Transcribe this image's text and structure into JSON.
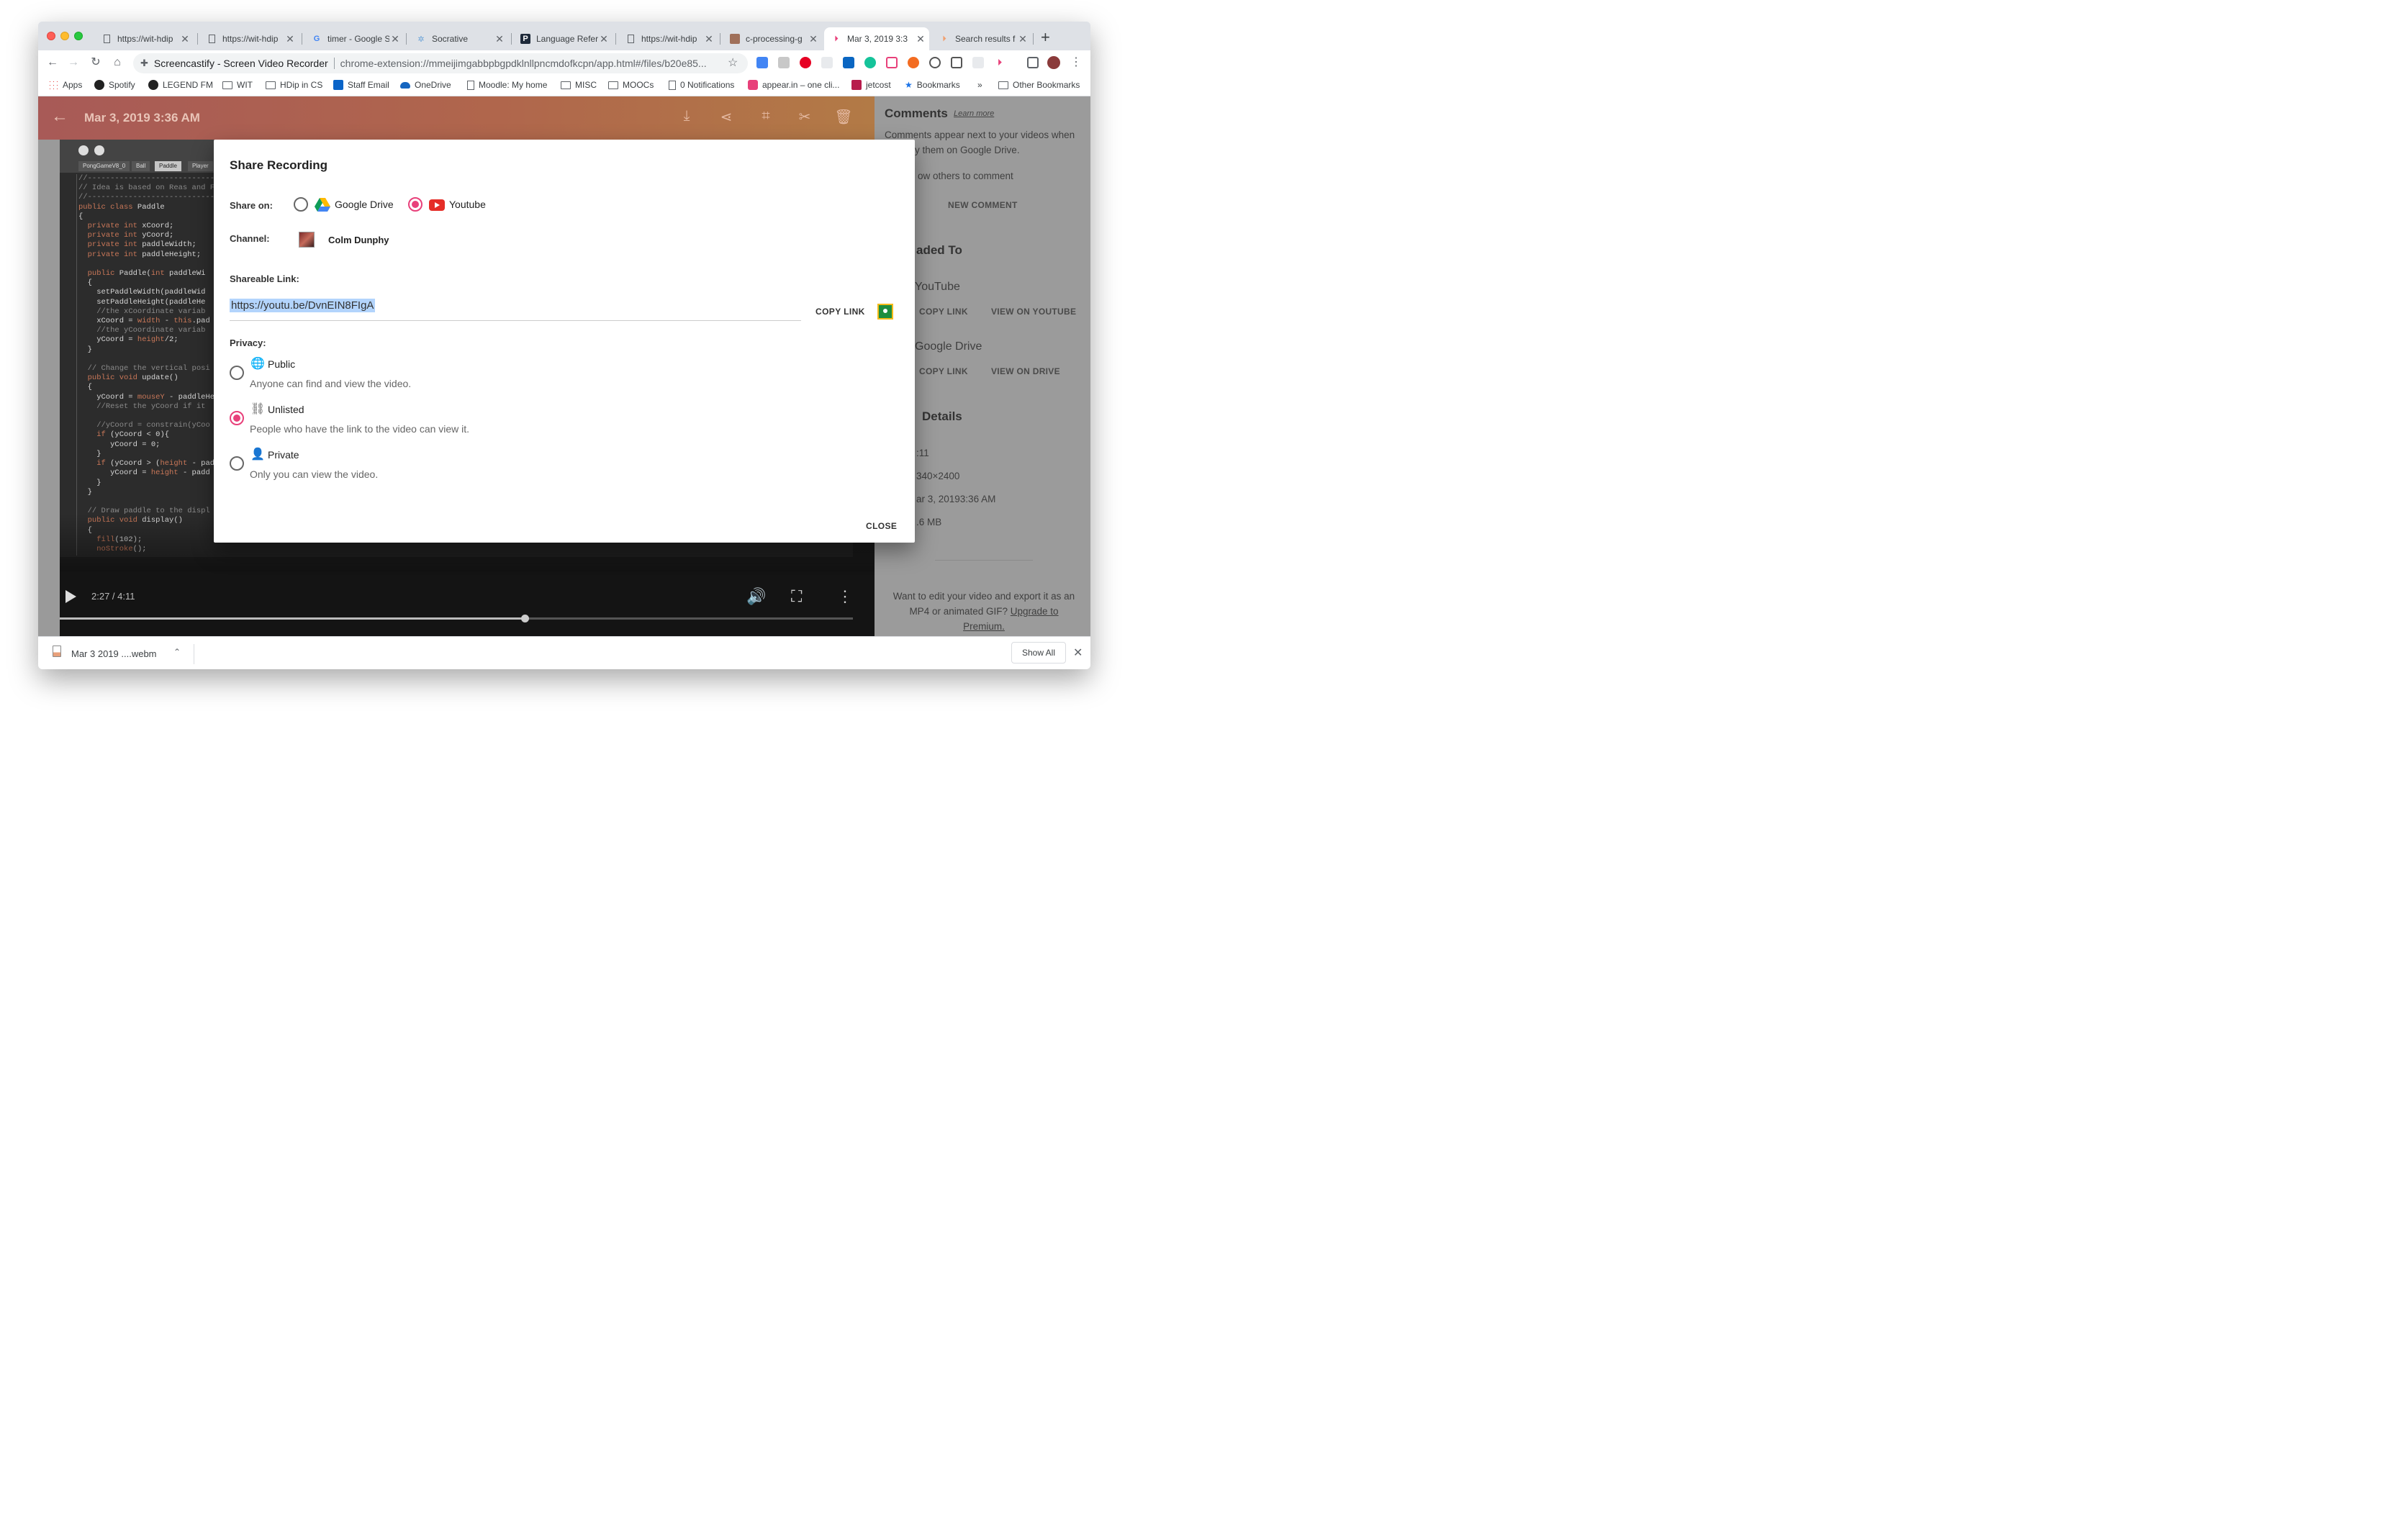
{
  "browser": {
    "tabs": [
      {
        "label": "https://wit-hdip",
        "icon": "page-icon",
        "active": false
      },
      {
        "label": "https://wit-hdip",
        "icon": "page-icon",
        "active": false
      },
      {
        "label": "timer - Google S",
        "icon": "google-icon",
        "active": false
      },
      {
        "label": "Socrative",
        "icon": "socrative-icon",
        "active": false
      },
      {
        "label": "Language Refer",
        "icon": "processing-p-icon",
        "active": false
      },
      {
        "label": "https://wit-hdip",
        "icon": "page-icon",
        "active": false
      },
      {
        "label": "c-processing-g",
        "icon": "image-icon",
        "active": false
      },
      {
        "label": "Mar 3, 2019 3:3",
        "icon": "screencastify-icon",
        "active": true
      },
      {
        "label": "Search results f",
        "icon": "screencastify-icon",
        "active": false
      }
    ],
    "omnibox": {
      "site": "Screencastify - Screen Video Recorder",
      "url": "chrome-extension://mmeijimgabbpbgpdklnllpncmdofkcpn/app.html#/files/b20e85..."
    },
    "bookmarks": [
      {
        "label": "Apps",
        "icon": "apps-grid-icon"
      },
      {
        "label": "Spotify",
        "icon": "spotify-icon"
      },
      {
        "label": "LEGEND FM",
        "icon": "radio-icon"
      },
      {
        "label": "WIT",
        "icon": "folder-icon"
      },
      {
        "label": "HDip in CS",
        "icon": "folder-icon"
      },
      {
        "label": "Staff Email",
        "icon": "outlook-icon"
      },
      {
        "label": "OneDrive",
        "icon": "onedrive-icon"
      },
      {
        "label": "Moodle: My home",
        "icon": "page-icon"
      },
      {
        "label": "MISC",
        "icon": "folder-icon"
      },
      {
        "label": "MOOCs",
        "icon": "folder-icon"
      },
      {
        "label": "0 Notifications",
        "icon": "page-icon"
      },
      {
        "label": "appear.in – one cli...",
        "icon": "appear-in-icon"
      },
      {
        "label": "jetcost",
        "icon": "jetcost-icon"
      },
      {
        "label": "Bookmarks",
        "icon": "star-icon"
      }
    ],
    "overflow": "»",
    "other_bookmarks": "Other Bookmarks"
  },
  "app": {
    "recording_title": "Mar 3, 2019 3:36 AM",
    "player": {
      "time": "2:27 / 4:11",
      "progress": 0.586
    },
    "ide": {
      "tabs": [
        "PongGameV8_0",
        "Ball",
        "Paddle",
        "Player"
      ],
      "selected_tab": "Paddle"
    }
  },
  "sidebar": {
    "title": "Comments",
    "learn_more": "Learn more",
    "text1a": "Comments appear next to your videos when",
    "text1b": "y them on Google Drive.",
    "text2": "ow others to comment",
    "new_comment": "NEW COMMENT",
    "uploaded_heading": "aded To",
    "youtube_label": "YouTube",
    "drive_label": "Google Drive",
    "copy_link": "COPY LINK",
    "view_youtube": "VIEW ON YOUTUBE",
    "view_drive": "VIEW ON DRIVE",
    "details_heading": " Details",
    "detail_duration": ":11",
    "detail_resolution": "340×2400",
    "detail_date": "ar 3, 20193:36 AM",
    "detail_size": ".6 MB",
    "promo_text": "Want to edit your video and export it as an MP4 or animated GIF?",
    "promo_link": "Upgrade to Premium."
  },
  "modal": {
    "title": "Share Recording",
    "share_on_label": "Share on:",
    "share_options": [
      "Google Drive",
      "Youtube"
    ],
    "share_selected": "Youtube",
    "channel_label": "Channel:",
    "channel_name": "Colm Dunphy",
    "shareable_label": "Shareable Link:",
    "link": "https://youtu.be/DvnEIN8FIgA",
    "copy_link": "COPY LINK",
    "privacy_label": "Privacy:",
    "privacy_options": [
      {
        "title": "Public",
        "desc": "Anyone can find and view the video.",
        "icon": "globe-icon"
      },
      {
        "title": "Unlisted",
        "desc": "People who have the link to the video can view it.",
        "icon": "link-icon"
      },
      {
        "title": "Private",
        "desc": "Only you can view the video.",
        "icon": "person-icon"
      }
    ],
    "privacy_selected": "Unlisted",
    "close": "CLOSE"
  },
  "downloads": {
    "file": "Mar 3 2019 ....webm",
    "show_all": "Show All"
  },
  "colors": {
    "accent": "#e8407a",
    "header_gradient_start": "#a85a57",
    "header_gradient_end": "#b27a46"
  }
}
